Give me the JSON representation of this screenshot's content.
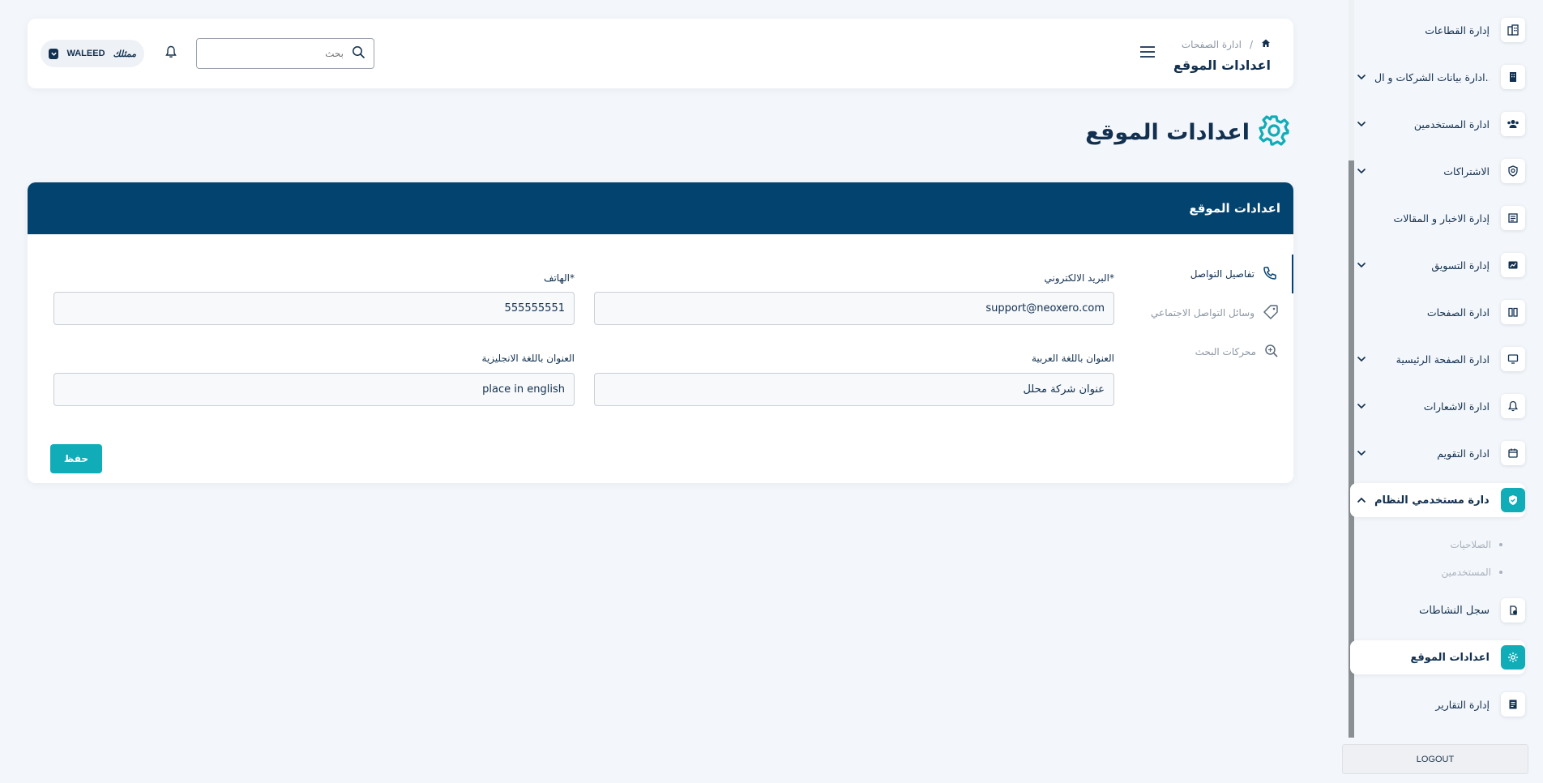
{
  "header": {
    "breadcrumb_parent": "ادارة الصفحات",
    "breadcrumb_sep": "/",
    "title": "اعدادات الموقع",
    "search_placeholder": "بحث",
    "user_name": "WALEED",
    "user_logo": "ممثلك"
  },
  "page": {
    "heading": "اعدادات الموقع"
  },
  "card": {
    "title": "اعدادات الموقع",
    "tabs": [
      {
        "label": "تفاصيل التواصل"
      },
      {
        "label": "وسائل التواصل الاجتماعي"
      },
      {
        "label": "محركات البحث"
      }
    ],
    "fields": {
      "email_label": "البريد الالكتروني*",
      "email_value": "support@neoxero.com",
      "phone_label": "الهاتف*",
      "phone_value": "555555551",
      "address_ar_label": "العنوان باللغة العربية",
      "address_ar_value": "عنوان شركة محلل",
      "address_en_label": "العنوان باللغة الانجليزية",
      "address_en_value": "place in english"
    },
    "save_label": "حفظ"
  },
  "sidebar": {
    "items": [
      {
        "label": "إدارة القطاعات",
        "icon": "building-icon"
      },
      {
        "label": "ادارة بيانات الشركات و ال...",
        "icon": "company-icon"
      },
      {
        "label": "ادارة المستخدمين",
        "icon": "users-icon"
      },
      {
        "label": "الاشتراكات",
        "icon": "badge-icon"
      },
      {
        "label": "إدارة الاخبار و المقالات",
        "icon": "news-icon"
      },
      {
        "label": "إدارة التسويق",
        "icon": "marketing-icon"
      },
      {
        "label": "ادارة الصفحات",
        "icon": "pages-icon"
      },
      {
        "label": "ادارة الصفحة الرئيسية",
        "icon": "monitor-icon"
      },
      {
        "label": "ادارة الاشعارات",
        "icon": "bell-icon"
      },
      {
        "label": "ادارة التقويم",
        "icon": "calendar-icon"
      },
      {
        "label": "ادارة مستخدمي النظام",
        "icon": "shield-icon"
      },
      {
        "label": "سجل النشاطات",
        "icon": "activity-icon"
      },
      {
        "label": "اعدادات الموقع",
        "icon": "settings-icon"
      },
      {
        "label": "إدارة التقارير",
        "icon": "reports-icon"
      }
    ],
    "subitems": [
      {
        "label": "الصلاحيات"
      },
      {
        "label": "المستخدمين"
      }
    ],
    "logout_label": "LOGOUT"
  },
  "colors": {
    "primary": "#03436f",
    "accent": "#10adb8",
    "background": "#f3f6fa"
  }
}
